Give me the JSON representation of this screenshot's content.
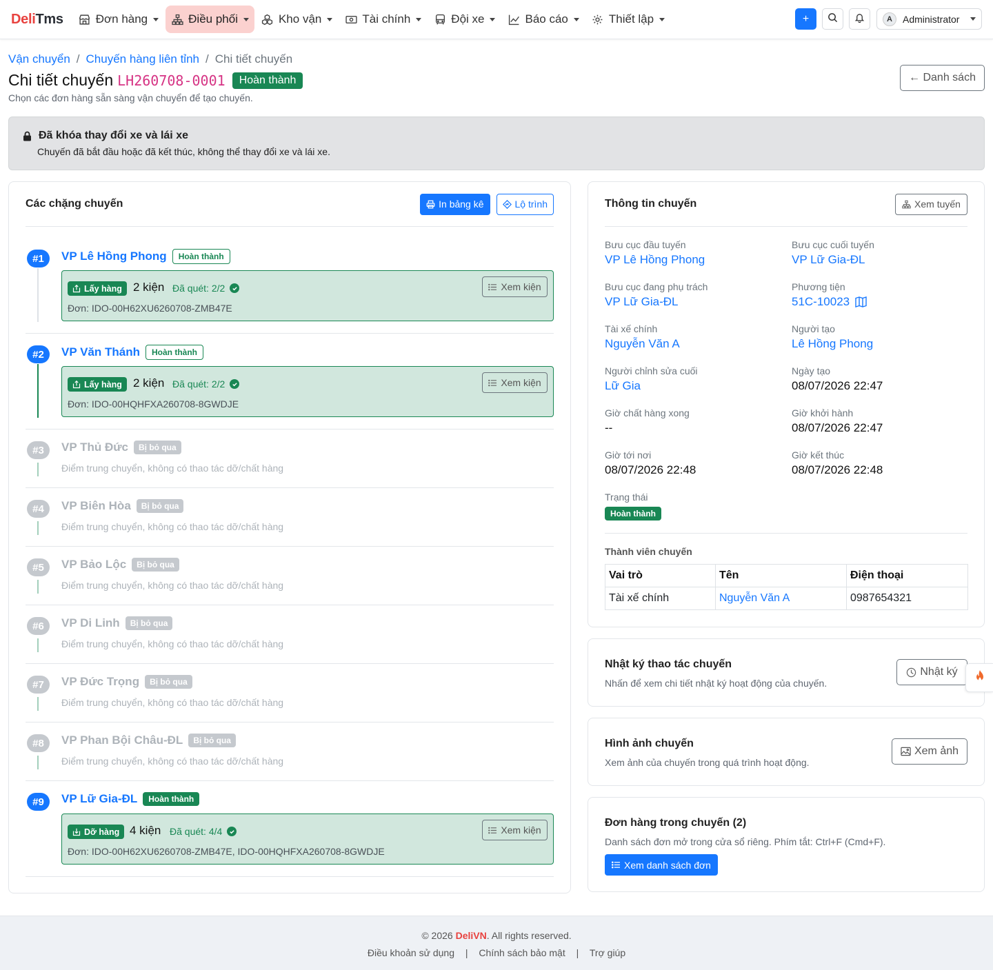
{
  "app": {
    "brand_part1": "Deli",
    "brand_part2": "Tms"
  },
  "nav": {
    "items": [
      {
        "label": "Đơn hàng",
        "icon": "store-icon"
      },
      {
        "label": "Điều phối",
        "icon": "sitemap-icon",
        "active": true
      },
      {
        "label": "Kho vận",
        "icon": "boxes-icon"
      },
      {
        "label": "Tài chính",
        "icon": "cash-icon"
      },
      {
        "label": "Đội xe",
        "icon": "bus-icon"
      },
      {
        "label": "Báo cáo",
        "icon": "chart-line-icon"
      },
      {
        "label": "Thiết lập",
        "icon": "gear-icon"
      }
    ],
    "add_label": "+",
    "user_initial": "A",
    "user_name": "Administrator"
  },
  "breadcrumb": {
    "items": [
      "Vận chuyển",
      "Chuyến hàng liên tỉnh",
      "Chi tiết chuyến"
    ],
    "separator": "/"
  },
  "header": {
    "title": "Chi tiết chuyến",
    "trip_code": "LH260708-0001",
    "status": "Hoàn thành",
    "subtitle": "Chọn các đơn hàng sẵn sàng vận chuyển để tạo chuyến.",
    "back_label": "← Danh sách"
  },
  "alert": {
    "title": "Đã khóa thay đổi xe và lái xe",
    "desc": "Chuyến đã bắt đầu hoặc đã kết thúc, không thể thay đổi xe và lái xe."
  },
  "stops_card": {
    "title": "Các chặng chuyến",
    "print_label": "In bảng kê",
    "route_label": "Lộ trình",
    "view_items_label": "Xem kiện",
    "skip_note": "Điểm trung chuyển, không có thao tác dỡ/chất hàng",
    "stops": [
      {
        "num": "#1",
        "name": "VP Lê Hồng Phong",
        "status": "Hoàn thành",
        "task": {
          "type": "Lấy hàng",
          "count": "2 kiện",
          "scan": "Đã quét: 2/2",
          "orders": "Đơn: IDO-00H62XU6260708-ZMB47E"
        }
      },
      {
        "num": "#2",
        "name": "VP Văn Thánh",
        "status": "Hoàn thành",
        "task": {
          "type": "Lấy hàng",
          "count": "2 kiện",
          "scan": "Đã quét: 2/2",
          "orders": "Đơn: IDO-00HQHFXA260708-8GWDJE"
        }
      },
      {
        "num": "#3",
        "name": "VP Thủ Đức",
        "status": "Bị bỏ qua"
      },
      {
        "num": "#4",
        "name": "VP Biên Hòa",
        "status": "Bị bỏ qua"
      },
      {
        "num": "#5",
        "name": "VP Bảo Lộc",
        "status": "Bị bỏ qua"
      },
      {
        "num": "#6",
        "name": "VP Di Linh",
        "status": "Bị bỏ qua"
      },
      {
        "num": "#7",
        "name": "VP Đức Trọng",
        "status": "Bị bỏ qua"
      },
      {
        "num": "#8",
        "name": "VP Phan Bội Châu-ĐL",
        "status": "Bị bỏ qua"
      },
      {
        "num": "#9",
        "name": "VP Lữ Gia-ĐL",
        "status": "Hoàn thành",
        "task": {
          "type": "Dỡ hàng",
          "count": "4 kiện",
          "scan": "Đã quét: 4/4",
          "orders": "Đơn: IDO-00H62XU6260708-ZMB47E, IDO-00HQHFXA260708-8GWDJE"
        }
      }
    ]
  },
  "info": {
    "title": "Thông tin chuyến",
    "route_btn": "Xem tuyến",
    "fields": {
      "origin": {
        "label": "Bưu cục đầu tuyến",
        "value": "VP Lê Hồng Phong"
      },
      "destination": {
        "label": "Bưu cục cuối tuyến",
        "value": "VP Lữ Gia-ĐL"
      },
      "in_charge": {
        "label": "Bưu cục đang phụ trách",
        "value": "VP Lữ Gia-ĐL"
      },
      "vehicle": {
        "label": "Phương tiện",
        "value": "51C-10023"
      },
      "driver": {
        "label": "Tài xế chính",
        "value": "Nguyễn Văn A"
      },
      "creator": {
        "label": "Người tạo",
        "value": "Lê Hồng Phong"
      },
      "last_editor": {
        "label": "Người chỉnh sửa cuối",
        "value": "Lữ Gia"
      },
      "created_at": {
        "label": "Ngày tạo",
        "value": "08/07/2026 22:47"
      },
      "loaded_at": {
        "label": "Giờ chất hàng xong",
        "value": "--"
      },
      "departed_at": {
        "label": "Giờ khởi hành",
        "value": "08/07/2026 22:47"
      },
      "arrived_at": {
        "label": "Giờ tới nơi",
        "value": "08/07/2026 22:48"
      },
      "finished_at": {
        "label": "Giờ kết thúc",
        "value": "08/07/2026 22:48"
      },
      "status": {
        "label": "Trạng thái",
        "value": "Hoàn thành"
      }
    },
    "members_title": "Thành viên chuyến",
    "members_headers": [
      "Vai trò",
      "Tên",
      "Điện thoại"
    ],
    "members": [
      {
        "role": "Tài xế chính",
        "name": "Nguyễn Văn A",
        "phone": "0987654321"
      }
    ]
  },
  "log_card": {
    "title": "Nhật ký thao tác chuyến",
    "desc": "Nhấn để xem chi tiết nhật ký hoạt động của chuyến.",
    "btn": "Nhật ký"
  },
  "photo_card": {
    "title": "Hình ảnh chuyến",
    "desc": "Xem ảnh của chuyến trong quá trình hoạt động.",
    "btn": "Xem ảnh"
  },
  "orders_card": {
    "title": "Đơn hàng trong chuyến (2)",
    "desc": "Danh sách đơn mở trong cửa sổ riêng. Phím tắt: Ctrl+F (Cmd+F).",
    "btn": "Xem danh sách đơn"
  },
  "footer": {
    "copy_prefix": "© 2026 ",
    "copy_brand": "DeliVN",
    "copy_suffix": ". All rights reserved.",
    "links": [
      "Điều khoản sử dụng",
      "Chính sách bảo mật",
      "Trợ giúp"
    ],
    "separator": "|"
  },
  "colors": {
    "brand_red": "#e8423f",
    "primary": "#1677ff",
    "success": "#198754",
    "success_bg": "#d1e7dd",
    "muted": "#adb3b9",
    "trip_code": "#d63384"
  }
}
